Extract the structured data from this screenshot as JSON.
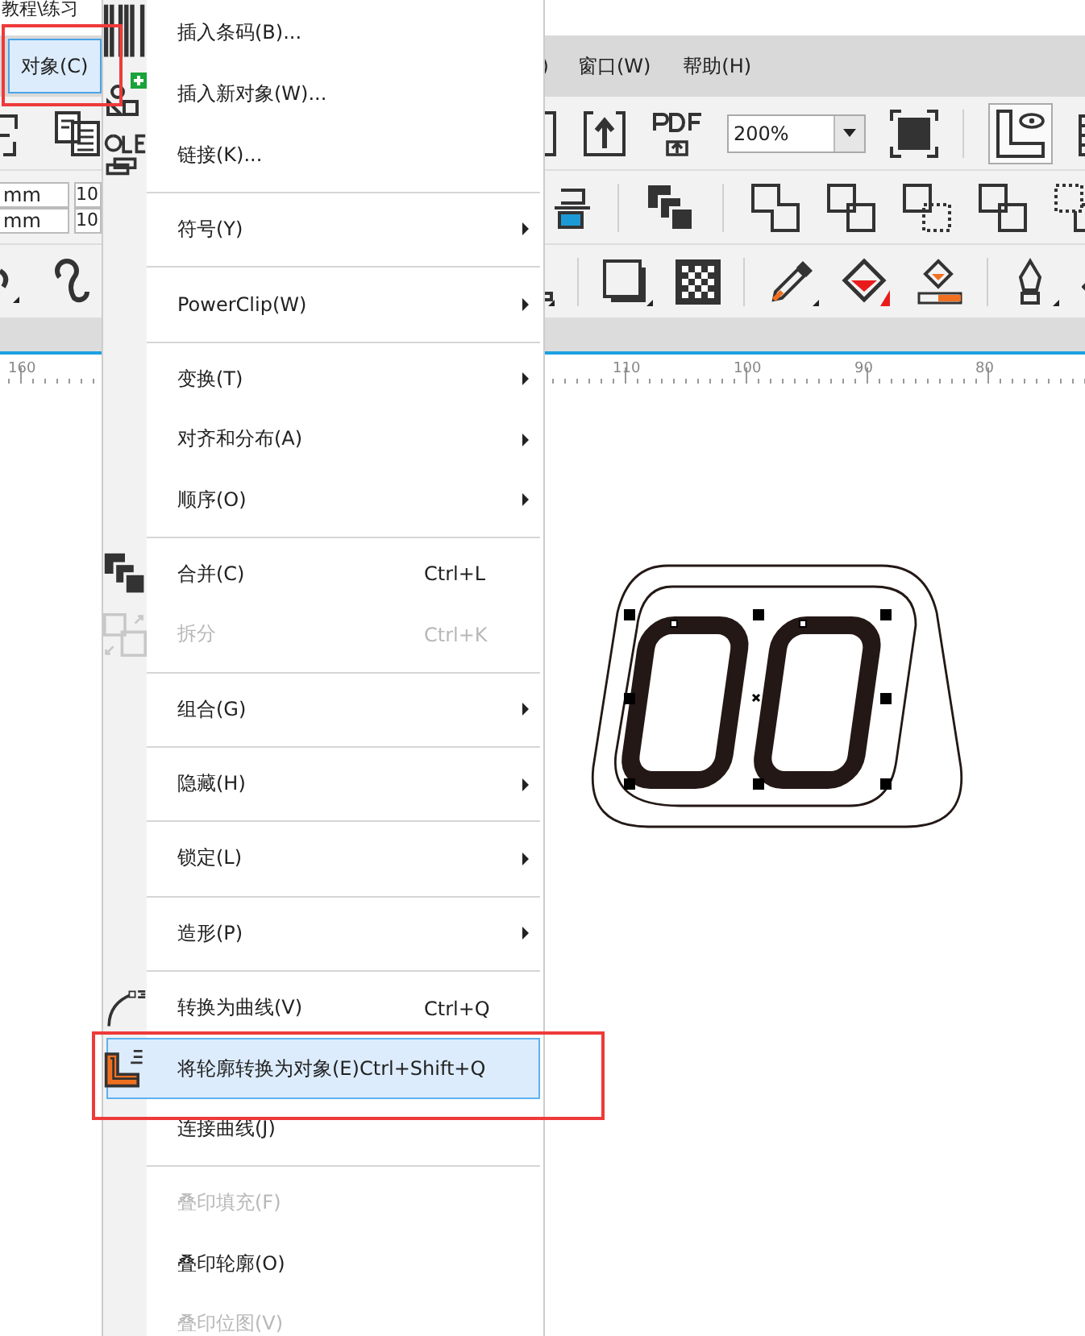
{
  "window": {
    "title": "教程\\练习"
  },
  "menubar": [
    {
      "label": "对象(C)",
      "selected": true
    },
    {
      "label": ")",
      "selected": false
    },
    {
      "label": "窗口(W)",
      "selected": false
    },
    {
      "label": "帮助(H)",
      "selected": false
    }
  ],
  "property_bar": {
    "zoom": "200%",
    "fields": [
      "mm",
      "10",
      "mm",
      "10"
    ]
  },
  "ruler": {
    "labels": [
      "160",
      "110",
      "100",
      "90",
      "80"
    ]
  },
  "menu": {
    "items": [
      {
        "kind": "command",
        "label": "插入条码(B)...",
        "submenu": false,
        "disabled": false,
        "selected": false
      },
      {
        "kind": "command",
        "label": "插入新对象(W)...",
        "submenu": false,
        "disabled": false,
        "selected": false
      },
      {
        "kind": "command",
        "label": "链接(K)...",
        "submenu": false,
        "disabled": false,
        "selected": false
      },
      {
        "kind": "separator"
      },
      {
        "kind": "command",
        "label": "符号(Y)",
        "submenu": true,
        "disabled": false,
        "selected": false
      },
      {
        "kind": "separator"
      },
      {
        "kind": "command",
        "label": "PowerClip(W)",
        "submenu": true,
        "disabled": false,
        "selected": false
      },
      {
        "kind": "separator"
      },
      {
        "kind": "command",
        "label": "变换(T)",
        "submenu": true,
        "disabled": false,
        "selected": false
      },
      {
        "kind": "command",
        "label": "对齐和分布(A)",
        "submenu": true,
        "disabled": false,
        "selected": false
      },
      {
        "kind": "command",
        "label": "顺序(O)",
        "submenu": true,
        "disabled": false,
        "selected": false
      },
      {
        "kind": "separator"
      },
      {
        "kind": "command",
        "label": "合并(C)",
        "shortcut": "Ctrl+L",
        "submenu": false,
        "disabled": false,
        "selected": false
      },
      {
        "kind": "command",
        "label": "拆分",
        "shortcut": "Ctrl+K",
        "submenu": false,
        "disabled": true,
        "selected": false
      },
      {
        "kind": "separator"
      },
      {
        "kind": "command",
        "label": "组合(G)",
        "submenu": true,
        "disabled": false,
        "selected": false
      },
      {
        "kind": "separator"
      },
      {
        "kind": "command",
        "label": "隐藏(H)",
        "submenu": true,
        "disabled": false,
        "selected": false
      },
      {
        "kind": "separator"
      },
      {
        "kind": "command",
        "label": "锁定(L)",
        "submenu": true,
        "disabled": false,
        "selected": false
      },
      {
        "kind": "separator"
      },
      {
        "kind": "command",
        "label": "造形(P)",
        "submenu": true,
        "disabled": false,
        "selected": false
      },
      {
        "kind": "separator"
      },
      {
        "kind": "command",
        "label": "转换为曲线(V)",
        "shortcut": "Ctrl+Q",
        "submenu": false,
        "disabled": false,
        "selected": false
      },
      {
        "kind": "command",
        "label": "将轮廓转换为对象(E)",
        "shortcut": "Ctrl+Shift+Q",
        "submenu": false,
        "disabled": false,
        "selected": true
      },
      {
        "kind": "command",
        "label": "连接曲线(J)",
        "submenu": false,
        "disabled": false,
        "selected": false
      },
      {
        "kind": "separator"
      },
      {
        "kind": "command",
        "label": "叠印填充(F)",
        "submenu": false,
        "disabled": true,
        "selected": false
      },
      {
        "kind": "command",
        "label": "叠印轮廓(O)",
        "submenu": false,
        "disabled": false,
        "selected": false
      },
      {
        "kind": "command",
        "label": "叠印位图(V)",
        "submenu": false,
        "disabled": true,
        "selected": false
      }
    ]
  }
}
